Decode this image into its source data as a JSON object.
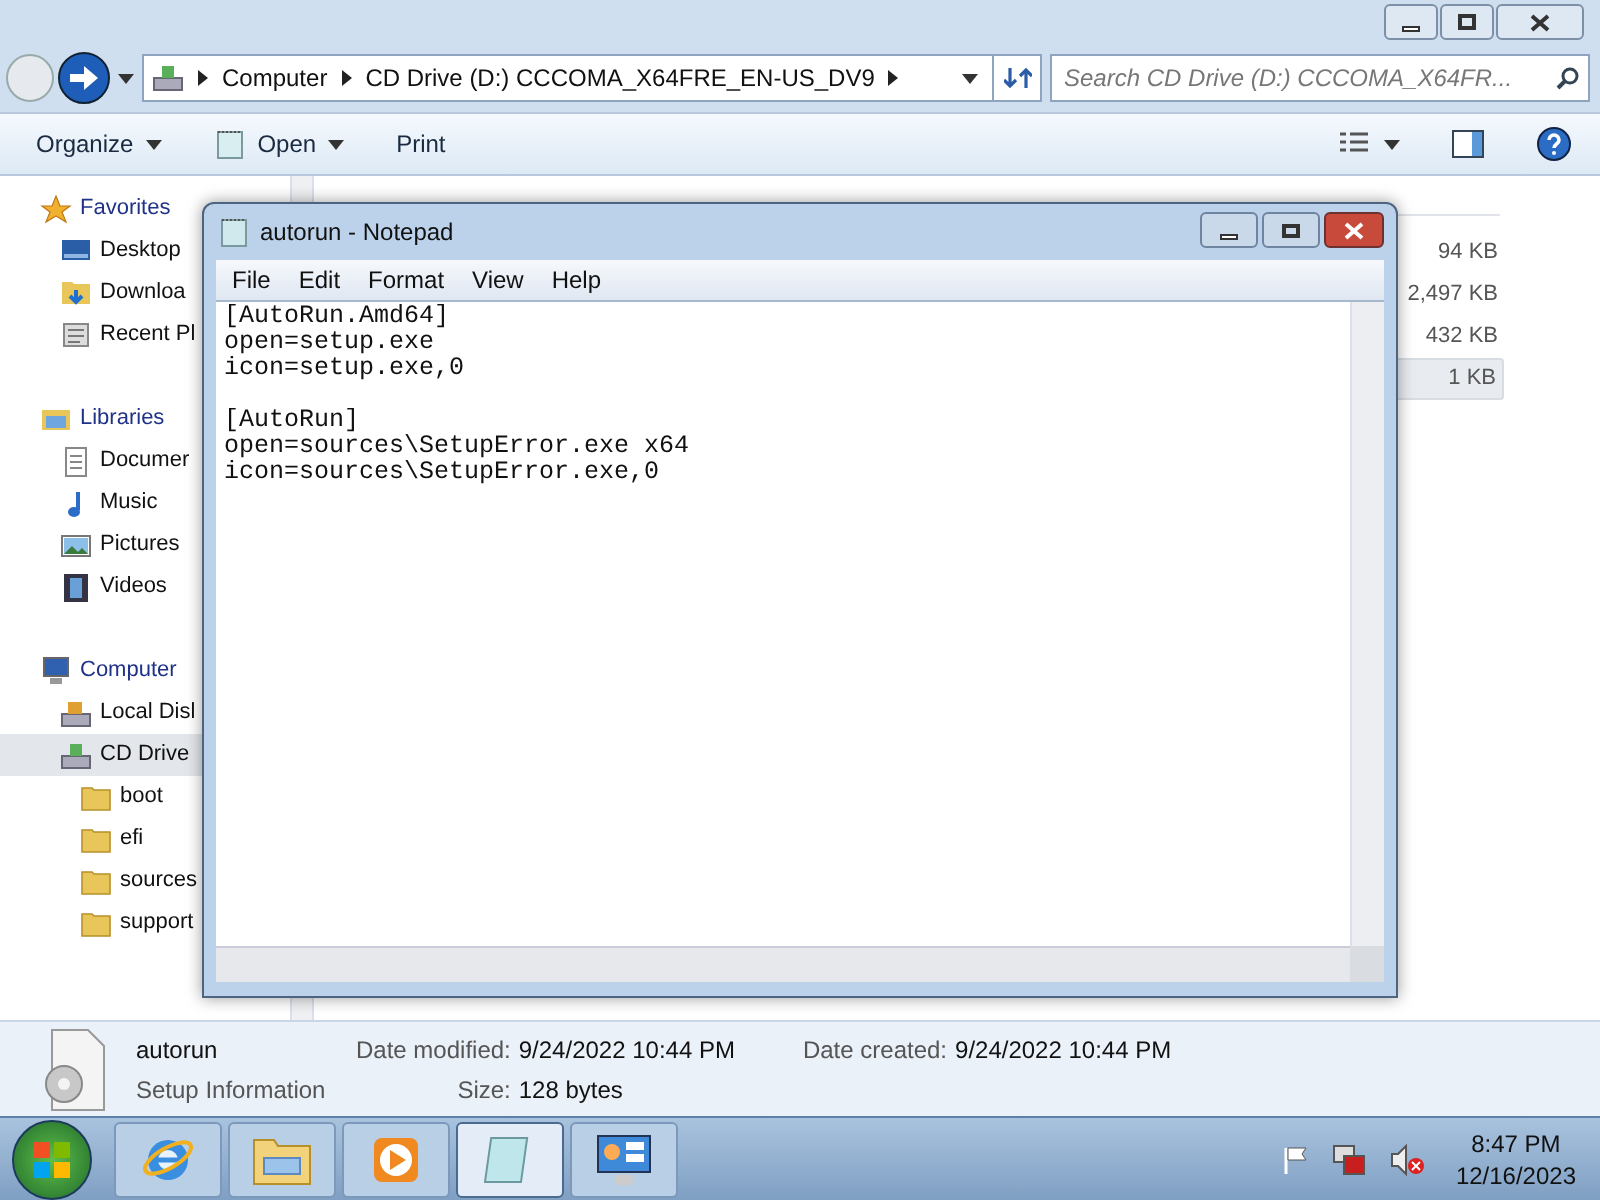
{
  "explorer": {
    "crumbs": [
      "Computer",
      "CD Drive (D:) CCCOMA_X64FRE_EN-US_DV9"
    ],
    "search": {
      "placeholder": "Search CD Drive (D:) CCCOMA_X64FR..."
    },
    "toolbar": [
      {
        "label": "Organize",
        "kind": "menu"
      },
      {
        "label": "Open",
        "kind": "open"
      },
      {
        "label": "Print",
        "kind": "plain"
      }
    ],
    "nav": [
      {
        "label": "Favorites",
        "kind": "star",
        "selected": false,
        "children": [
          {
            "label": "Desktop",
            "kind": "desktop",
            "selected": false
          },
          {
            "label": "Downloa",
            "kind": "download",
            "selected": false
          },
          {
            "label": "Recent Pl",
            "kind": "recent",
            "selected": false
          }
        ]
      },
      {
        "label": "Libraries",
        "kind": "library",
        "selected": false,
        "children": [
          {
            "label": "Documer",
            "kind": "document",
            "selected": false
          },
          {
            "label": "Music",
            "kind": "music",
            "selected": false
          },
          {
            "label": "Pictures",
            "kind": "pictures",
            "selected": false
          },
          {
            "label": "Videos",
            "kind": "videos",
            "selected": false
          }
        ]
      },
      {
        "label": "Computer",
        "kind": "computer",
        "selected": false,
        "children": [
          {
            "label": "Local Disl",
            "kind": "disk",
            "selected": false
          },
          {
            "label": "CD Drive",
            "kind": "cd",
            "selected": true,
            "children": [
              {
                "label": "boot",
                "kind": "folder",
                "selected": false
              },
              {
                "label": "efi",
                "kind": "folder",
                "selected": false
              },
              {
                "label": "sources",
                "kind": "folder",
                "selected": false
              },
              {
                "label": "support",
                "kind": "folder",
                "selected": false
              }
            ]
          }
        ]
      }
    ],
    "files": [
      {
        "size": "94 KB",
        "selected": false
      },
      {
        "size": "2,497 KB",
        "selected": false
      },
      {
        "size": "432 KB",
        "selected": false
      },
      {
        "size": "1 KB",
        "selected": true
      }
    ]
  },
  "notepad": {
    "title": "autorun - Notepad",
    "menu": [
      "File",
      "Edit",
      "Format",
      "View",
      "Help"
    ],
    "sections": [
      [
        "[AutoRun.Amd64]",
        "open=setup.exe",
        "icon=setup.exe,0"
      ],
      [
        "[AutoRun]",
        "open=sources\\SetupError.exe x64",
        "icon=sources\\SetupError.exe,0"
      ]
    ]
  },
  "details": {
    "name": "autorun",
    "type": "Setup Information",
    "fields": [
      {
        "label": "Date modified:",
        "value": "9/24/2022 10:44 PM"
      },
      {
        "label": "Size:",
        "value": "128 bytes"
      },
      {
        "label": "Date created:",
        "value": "9/24/2022 10:44 PM"
      }
    ]
  },
  "taskbar": {
    "apps": [
      {
        "kind": "browser",
        "active": false
      },
      {
        "kind": "explorer",
        "active": false
      },
      {
        "kind": "media",
        "active": false
      },
      {
        "kind": "notepad",
        "active": true
      },
      {
        "kind": "panel",
        "active": false
      }
    ],
    "time": "8:47 PM",
    "date": "12/16/2023"
  }
}
